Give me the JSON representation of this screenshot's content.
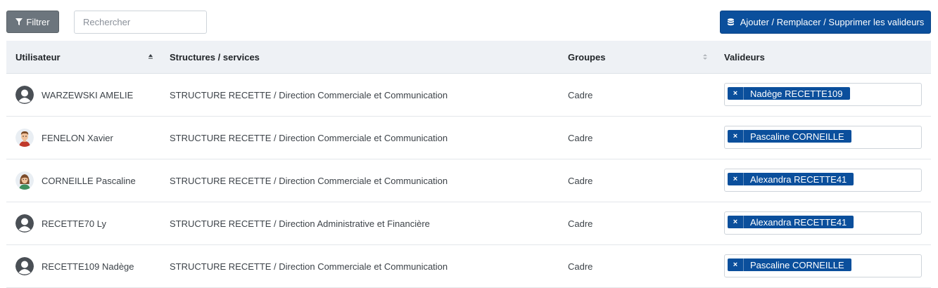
{
  "toolbar": {
    "filter_label": "Filtrer",
    "search_placeholder": "Rechercher",
    "search_value": "",
    "add_label": "Ajouter / Remplacer / Supprimer les valideurs"
  },
  "table": {
    "columns": [
      "Utilisateur",
      "Structures / services",
      "Groupes",
      "Valideurs"
    ],
    "rows": [
      {
        "user": "WARZEWSKI AMELIE",
        "avatar": "default-avatar-icon",
        "structure": "STRUCTURE RECETTE / Direction Commerciale et Communication",
        "group": "Cadre",
        "validator": "Nadège RECETTE109"
      },
      {
        "user": "FENELON Xavier",
        "avatar": "man-avatar-icon",
        "structure": "STRUCTURE RECETTE / Direction Commerciale et Communication",
        "group": "Cadre",
        "validator": "Pascaline CORNEILLE"
      },
      {
        "user": "CORNEILLE Pascaline",
        "avatar": "woman-avatar-icon",
        "structure": "STRUCTURE RECETTE / Direction Commerciale et Communication",
        "group": "Cadre",
        "validator": "Alexandra RECETTE41"
      },
      {
        "user": "RECETTE70 Ly",
        "avatar": "default-avatar-icon",
        "structure": "STRUCTURE RECETTE / Direction Administrative et Financière",
        "group": "Cadre",
        "validator": "Alexandra RECETTE41"
      },
      {
        "user": "RECETTE109 Nadège",
        "avatar": "default-avatar-icon",
        "structure": "STRUCTURE RECETTE / Direction Commerciale et Communication",
        "group": "Cadre",
        "validator": "Pascaline CORNEILLE"
      }
    ]
  },
  "colors": {
    "primary": "#0b4f9c",
    "filter_button": "#6c757d",
    "header_bg": "#eef1f5"
  }
}
